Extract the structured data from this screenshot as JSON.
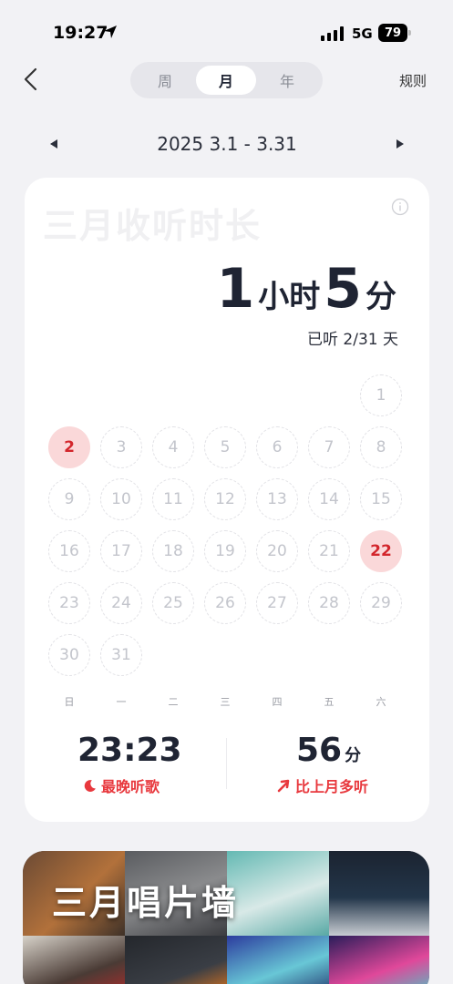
{
  "status_bar": {
    "time": "19:27",
    "network": "5G",
    "battery": "79"
  },
  "header": {
    "tabs": [
      {
        "label": "周",
        "active": false
      },
      {
        "label": "月",
        "active": true
      },
      {
        "label": "年",
        "active": false
      }
    ],
    "rules_label": "规则"
  },
  "date_nav": {
    "range": "2025 3.1 - 3.31"
  },
  "summary_card": {
    "title": "三月收听时长",
    "duration": {
      "hours": "1",
      "hours_unit": "小时",
      "minutes": "5",
      "minutes_unit": "分"
    },
    "listened_days": "已听 2/31 天",
    "calendar": {
      "weekdays": [
        "日",
        "一",
        "二",
        "三",
        "四",
        "五",
        "六"
      ],
      "first_weekday_index": 6,
      "days": [
        "1",
        "2",
        "3",
        "4",
        "5",
        "6",
        "7",
        "8",
        "9",
        "10",
        "11",
        "12",
        "13",
        "14",
        "15",
        "16",
        "17",
        "18",
        "19",
        "20",
        "21",
        "22",
        "23",
        "24",
        "25",
        "26",
        "27",
        "28",
        "29",
        "30",
        "31"
      ],
      "listened_days": [
        2,
        22
      ]
    },
    "latest_listen": {
      "value": "23:23",
      "label": "最晚听歌"
    },
    "compare": {
      "value": "56",
      "unit": "分",
      "label": "比上月多听"
    }
  },
  "record_wall": {
    "title": "三月唱片墙"
  },
  "colors": {
    "accent_red": "#e8383d",
    "highlight_bg": "#fad8d9",
    "text_dark": "#1f2433",
    "page_bg": "#f2f2f5"
  },
  "icons": [
    "location-arrow-icon",
    "signal-icon",
    "battery-icon",
    "back-chevron-icon",
    "prev-triangle-icon",
    "next-triangle-icon",
    "info-icon",
    "moon-icon",
    "arrow-up-right-icon"
  ]
}
